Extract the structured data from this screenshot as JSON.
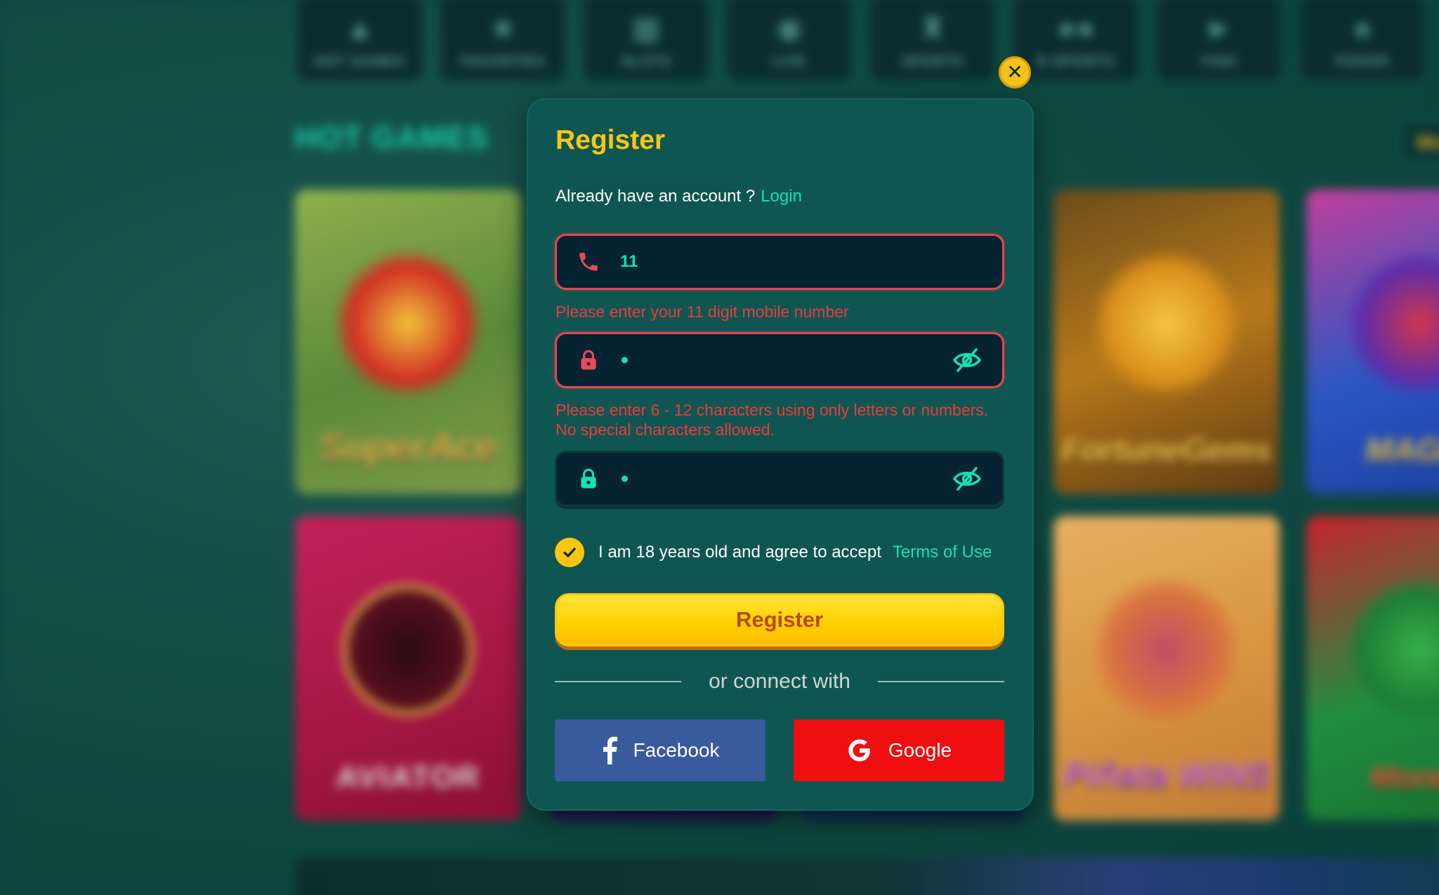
{
  "lobby": {
    "categories": [
      {
        "label": "HOT GAMES",
        "icon": "flame-icon"
      },
      {
        "label": "FAVORITES",
        "icon": "star-icon"
      },
      {
        "label": "SLOTS",
        "icon": "slot-icon"
      },
      {
        "label": "LIVE",
        "icon": "chip-icon"
      },
      {
        "label": "SPORTS",
        "icon": "trophy-icon"
      },
      {
        "label": "E-SPORTS",
        "icon": "gamepad-icon"
      },
      {
        "label": "FISH",
        "icon": "fish-icon"
      },
      {
        "label": "POKER",
        "icon": "cards-icon"
      }
    ],
    "section_title": "HOT GAMES",
    "more_label": "Mo",
    "games": [
      {
        "name": "SuperAce"
      },
      {
        "name": "AVIATOR"
      },
      {
        "name": "FortuneGems"
      },
      {
        "name": "Piñata WINS"
      },
      {
        "name": "MAGIC"
      },
      {
        "name": "Money"
      }
    ]
  },
  "modal": {
    "title": "Register",
    "login_prompt": "Already have an account ?",
    "login_link": "Login",
    "phone": {
      "value": "11",
      "error": "Please enter your 11 digit mobile number",
      "icon": "phone-icon"
    },
    "password": {
      "error": "Please enter 6 - 12 characters using only letters or numbers. No special characters allowed.",
      "icon": "lock-icon"
    },
    "confirm_password": {
      "icon": "lock-icon"
    },
    "terms_text": "I am 18 years old and agree to accept",
    "terms_link": "Terms of Use",
    "terms_checked": true,
    "register_label": "Register",
    "divider_text": "or connect with",
    "facebook_label": "Facebook",
    "google_label": "Google",
    "close_icon": "close-icon"
  },
  "colors": {
    "accent_yellow": "#f9c514",
    "accent_teal": "#17e0b6",
    "error_red": "#ec3a3a",
    "modal_bg": "#0f5652",
    "facebook_blue": "#3a5a9e",
    "google_red": "#ef0e10"
  }
}
